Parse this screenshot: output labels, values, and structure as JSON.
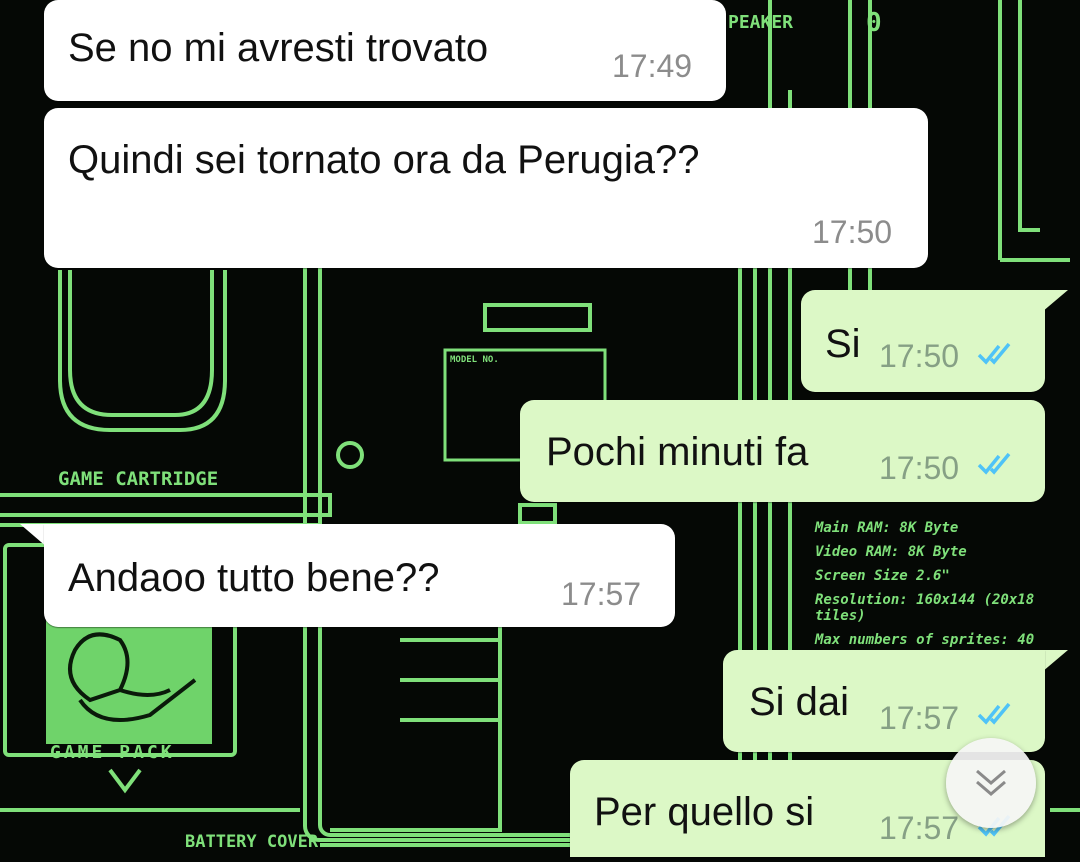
{
  "wallpaper": {
    "labels": {
      "speaker": "PEAKER",
      "model": "MODEL NO.",
      "game_cartridge": "GAME CARTRIDGE",
      "game_pack": "GAME PACK",
      "battery_cover": "BATTERY COVER",
      "zero": "0",
      "specs": [
        "Main RAM: 8K Byte",
        "Video RAM: 8K Byte",
        "Screen Size 2.6\"",
        "Resolution: 160x144 (20x18 tiles)",
        "Max numbers of sprites: 40"
      ]
    }
  },
  "messages": [
    {
      "direction": "incoming",
      "text": "Se no mi avresti trovato",
      "time": "17:49"
    },
    {
      "direction": "incoming",
      "text": "Quindi sei tornato ora da Perugia??",
      "time": "17:50"
    },
    {
      "direction": "outgoing",
      "text": "Si",
      "time": "17:50",
      "status": "read"
    },
    {
      "direction": "outgoing",
      "text": "Pochi minuti fa",
      "time": "17:50",
      "status": "read"
    },
    {
      "direction": "incoming",
      "text": "Andaoo tutto bene??",
      "time": "17:57"
    },
    {
      "direction": "outgoing",
      "text": "Si dai",
      "time": "17:57",
      "status": "read"
    },
    {
      "direction": "outgoing",
      "text": "Per quello si",
      "time": "17:57",
      "status": "read"
    }
  ],
  "colors": {
    "incoming_bubble": "#ffffff",
    "outgoing_bubble": "#dcf8c6",
    "read_ticks": "#4fc3f7",
    "wallpaper_line": "#7fe07a",
    "wallpaper_bg": "#050805"
  },
  "icons": {
    "read_receipt": "double-check-icon",
    "scroll_down": "double-chevron-down-icon"
  }
}
